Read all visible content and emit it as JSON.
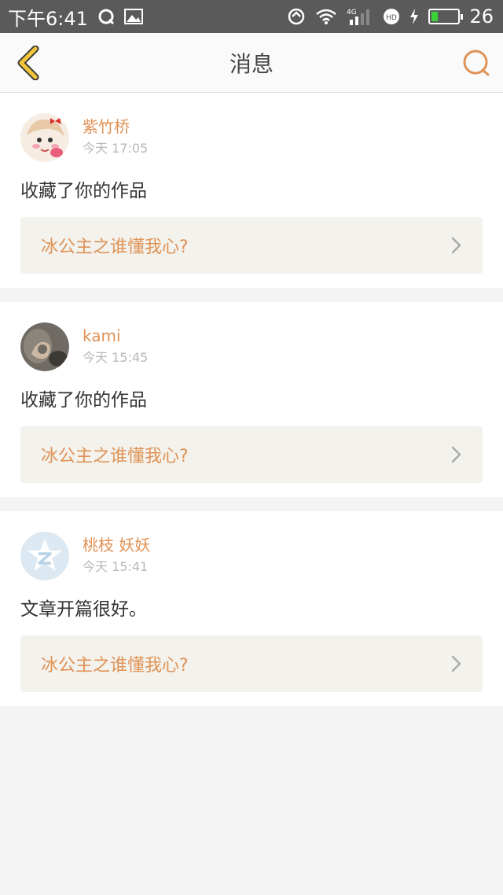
{
  "status_bar": {
    "time": "下午6:41",
    "battery_level": "26",
    "network": "4G"
  },
  "nav": {
    "title": "消息"
  },
  "messages": [
    {
      "user": "紫竹桥",
      "time": "今天 17:05",
      "text": "收藏了你的作品",
      "work_title": "冰公主之谁懂我心?"
    },
    {
      "user": "kami",
      "time": "今天 15:45",
      "text": "收藏了你的作品",
      "work_title": "冰公主之谁懂我心?"
    },
    {
      "user": "桃枝 妖妖",
      "time": "今天 15:41",
      "text": "文章开篇很好。",
      "work_title": "冰公主之谁懂我心?"
    }
  ],
  "colors": {
    "accent": "#e09256",
    "back_arrow": "#f2c53a",
    "status_bar": "#5a5a5a"
  }
}
